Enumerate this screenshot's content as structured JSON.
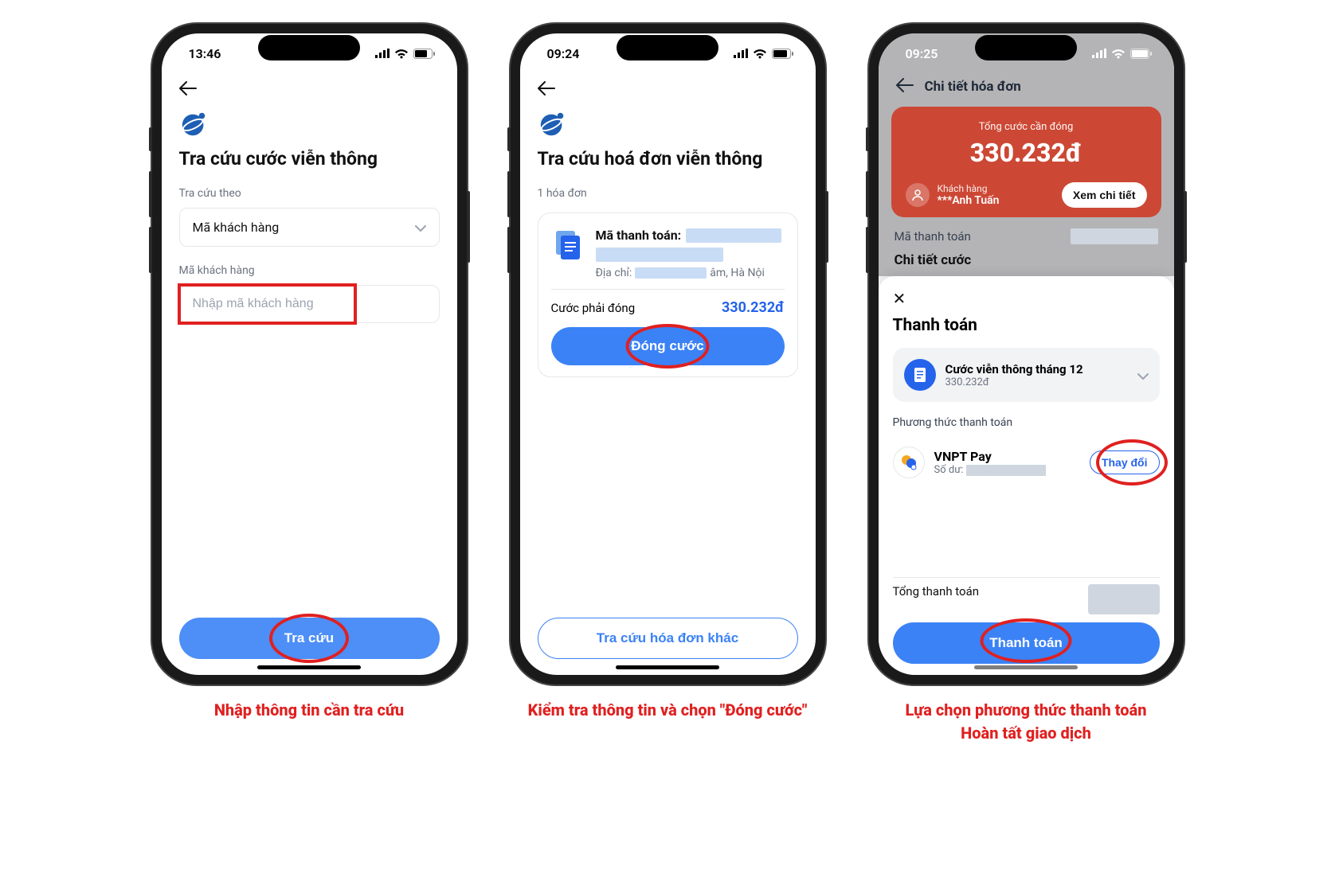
{
  "captions": {
    "s1": "Nhập thông tin cần tra cứu",
    "s2": "Kiểm tra thông tin và chọn \"Đóng cước\"",
    "s3_l1": "Lựa chọn phương thức thanh toán",
    "s3_l2": "Hoàn tất giao dịch"
  },
  "screen1": {
    "status_time": "13:46",
    "title": "Tra cứu cước viễn thông",
    "lookup_label": "Tra cứu theo",
    "lookup_value": "Mã khách hàng",
    "field_label": "Mã khách hàng",
    "field_placeholder": "Nhập mã khách hàng",
    "submit_label": "Tra cứu"
  },
  "screen2": {
    "status_time": "09:24",
    "title": "Tra cứu hoá đơn viễn thông",
    "count_label": "1 hóa đơn",
    "payment_code_label": "Mã thanh toán:",
    "address_label": "Địa chỉ:",
    "address_suffix": "âm, Hà Nội",
    "amount_label": "Cước phải đóng",
    "amount_value": "330.232đ",
    "pay_btn": "Đóng cước",
    "other_btn": "Tra cứu hóa đơn khác"
  },
  "screen3": {
    "status_time": "09:25",
    "header_title": "Chi tiết hóa đơn",
    "total_due_label": "Tổng cước cần đóng",
    "total_due_value": "330.232đ",
    "customer_label": "Khách hàng",
    "customer_name": "***Anh Tuấn",
    "detail_btn": "Xem chi tiết",
    "payment_code_label": "Mã thanh toán",
    "fee_detail_title": "Chi tiết cước",
    "sheet_title": "Thanh toán",
    "item_title": "Cước viễn thông tháng 12",
    "item_amount": "330.232đ",
    "method_section": "Phương thức thanh toán",
    "method_name": "VNPT Pay",
    "method_balance_label": "Số dư:",
    "change_label": "Thay đổi",
    "total_label": "Tổng thanh toán",
    "pay_btn": "Thanh toán"
  }
}
